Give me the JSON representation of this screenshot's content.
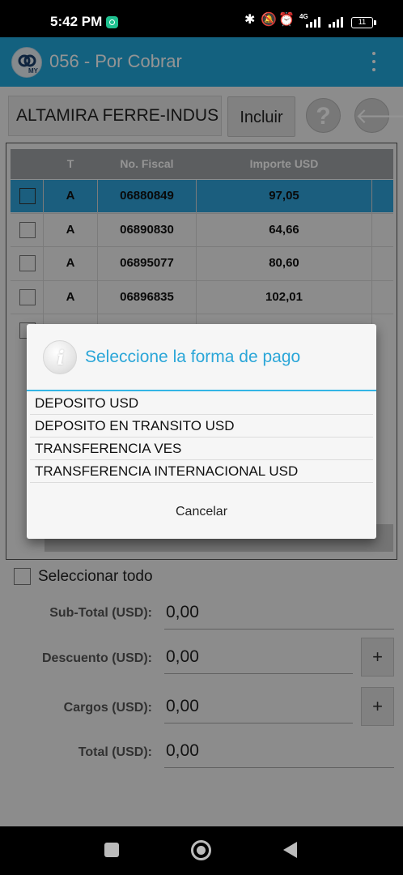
{
  "status_bar": {
    "time": "5:42 PM",
    "network": "4G",
    "battery": "11"
  },
  "app_bar": {
    "title": "056 - Por Cobrar",
    "logo_text": "MY"
  },
  "client": {
    "name": "ALTAMIRA FERRE-INDUS",
    "include_label": "Incluir",
    "help_glyph": "?",
    "back_glyph": "🡐"
  },
  "table": {
    "headers": [
      "",
      "T",
      "No. Fiscal",
      "Importe USD"
    ],
    "rows": [
      {
        "type": "A",
        "fiscal": "06880849",
        "amount": "97,05",
        "selected": true
      },
      {
        "type": "A",
        "fiscal": "06890830",
        "amount": "64,66",
        "selected": false
      },
      {
        "type": "A",
        "fiscal": "06895077",
        "amount": "80,60",
        "selected": false
      },
      {
        "type": "A",
        "fiscal": "06896835",
        "amount": "102,01",
        "selected": false
      }
    ]
  },
  "select_all_label": "Seleccionar todo",
  "summary": {
    "subtotal_label": "Sub-Total (USD):",
    "subtotal_value": "0,00",
    "discount_label": "Descuento (USD):",
    "discount_value": "0,00",
    "charges_label": "Cargos (USD):",
    "charges_value": "0,00",
    "total_label": "Total (USD):",
    "total_value": "0,00",
    "plus_label": "+"
  },
  "dialog": {
    "title": "Seleccione la forma de pago",
    "icon_glyph": "i",
    "options": [
      "DEPOSITO USD",
      "DEPOSITO EN TRANSITO USD",
      "TRANSFERENCIA VES",
      "TRANSFERENCIA INTERNACIONAL USD"
    ],
    "cancel_label": "Cancelar"
  },
  "colors": {
    "app_bar": "#21a8db",
    "selected_row": "#2fa3d9",
    "dialog_accent": "#33b5e5"
  }
}
